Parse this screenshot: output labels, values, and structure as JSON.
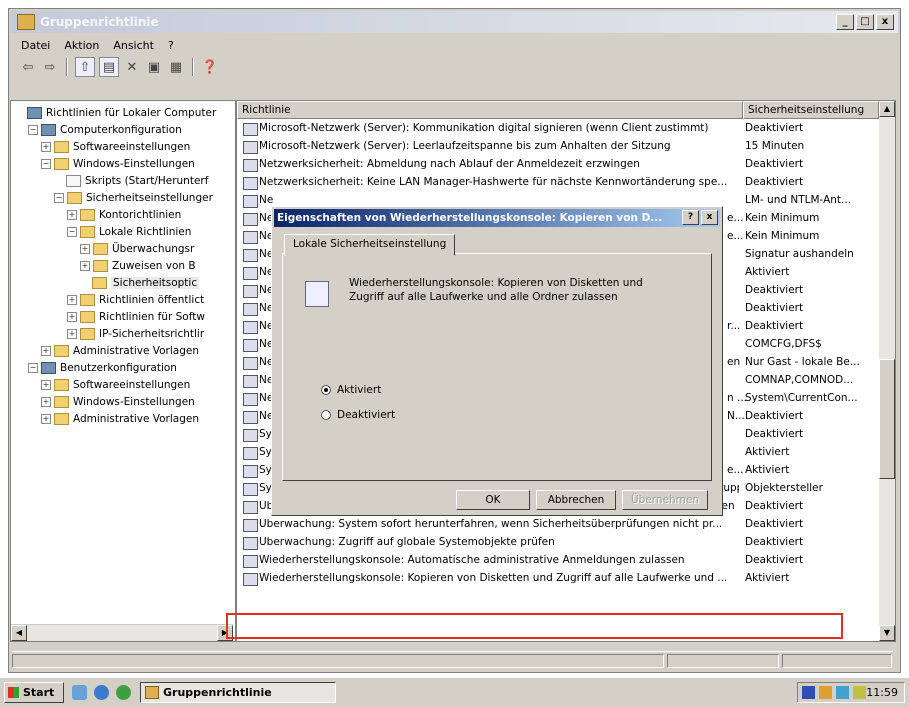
{
  "window": {
    "title": "Gruppenrichtlinie",
    "minimize": "_",
    "maximize": "□",
    "close": "x"
  },
  "menu": [
    "Datei",
    "Aktion",
    "Ansicht",
    "?"
  ],
  "tree": [
    {
      "label": "Richtlinien für Lokaler Computer",
      "indent": 0,
      "expander": "",
      "icon": "computer-policy-icon"
    },
    {
      "label": "Computerkonfiguration",
      "indent": 1,
      "expander": "−",
      "icon": "computer-icon"
    },
    {
      "label": "Softwareeinstellungen",
      "indent": 2,
      "expander": "+",
      "icon": "folder-icon"
    },
    {
      "label": "Windows-Einstellungen",
      "indent": 2,
      "expander": "−",
      "icon": "folder-icon"
    },
    {
      "label": "Skripts (Start/Herunterf",
      "indent": 3,
      "expander": "",
      "icon": "scripts-icon"
    },
    {
      "label": "Sicherheitseinstellunger",
      "indent": 3,
      "expander": "−",
      "icon": "security-icon"
    },
    {
      "label": "Kontorichtlinien",
      "indent": 4,
      "expander": "+",
      "icon": "folder-icon"
    },
    {
      "label": "Lokale Richtlinien",
      "indent": 4,
      "expander": "−",
      "icon": "folder-icon"
    },
    {
      "label": "Überwachungsr",
      "indent": 5,
      "expander": "+",
      "icon": "folder-icon"
    },
    {
      "label": "Zuweisen von B",
      "indent": 5,
      "expander": "+",
      "icon": "folder-icon"
    },
    {
      "label": "Sicherheitsoptic",
      "indent": 5,
      "expander": "",
      "icon": "folder-icon",
      "selected": true
    },
    {
      "label": "Richtlinien öffentlict",
      "indent": 4,
      "expander": "+",
      "icon": "folder-icon"
    },
    {
      "label": "Richtlinien für Softw",
      "indent": 4,
      "expander": "+",
      "icon": "folder-icon"
    },
    {
      "label": "IP-Sicherheitsrichtlir",
      "indent": 4,
      "expander": "+",
      "icon": "ip-security-icon"
    },
    {
      "label": "Administrative Vorlagen",
      "indent": 2,
      "expander": "+",
      "icon": "folder-icon"
    },
    {
      "label": "Benutzerkonfiguration",
      "indent": 1,
      "expander": "−",
      "icon": "user-icon"
    },
    {
      "label": "Softwareeinstellungen",
      "indent": 2,
      "expander": "+",
      "icon": "folder-icon"
    },
    {
      "label": "Windows-Einstellungen",
      "indent": 2,
      "expander": "+",
      "icon": "folder-icon"
    },
    {
      "label": "Administrative Vorlagen",
      "indent": 2,
      "expander": "+",
      "icon": "folder-icon"
    }
  ],
  "list": {
    "col_policy": "Richtlinie",
    "col_setting": "Sicherheitseinstellung",
    "rows": [
      {
        "policy": "Microsoft-Netzwerk (Server): Kommunikation digital signieren (wenn Client zustimmt)",
        "value": "Deaktiviert"
      },
      {
        "policy": "Microsoft-Netzwerk (Server): Leerlaufzeitspanne bis zum Anhalten der Sitzung",
        "value": "15 Minuten"
      },
      {
        "policy": "Netzwerksicherheit: Abmeldung nach Ablauf der Anmeldezeit erzwingen",
        "value": "Deaktiviert"
      },
      {
        "policy": "Netzwerksicherheit: Keine LAN Manager-Hashwerte für nächste Kennwortänderung spe...",
        "value": "Deaktiviert"
      },
      {
        "policy": "Ne",
        "value": "LM- und NTLM-Ant..."
      },
      {
        "policy": "Ne",
        "value": "Kein Minimum"
      },
      {
        "policy": "Ne",
        "value": "Kein Minimum"
      },
      {
        "policy": "Ne",
        "value": "Signatur aushandeln"
      },
      {
        "policy": "Ne",
        "value": "Aktiviert"
      },
      {
        "policy": "Ne",
        "value": "Deaktiviert"
      },
      {
        "policy": "Ne",
        "value": "Deaktiviert"
      },
      {
        "policy": "Ne",
        "value": "Deaktiviert"
      },
      {
        "policy": "Ne",
        "value": "COMCFG,DFS$"
      },
      {
        "policy": "Ne",
        "value": "Nur Gast - lokale Be..."
      },
      {
        "policy": "Ne",
        "value": "COMNAP,COMNOD..."
      },
      {
        "policy": "Ne",
        "value": "System\\CurrentCon..."
      },
      {
        "policy": "Ne",
        "value": "Deaktiviert"
      },
      {
        "policy": "Sy",
        "value": "Deaktiviert"
      },
      {
        "policy": "Sy",
        "value": "Aktiviert"
      },
      {
        "policy": "Sy",
        "value": "Aktiviert"
      },
      {
        "policy": "Systemobjekte: Standardbesitzer für Objekte, die von Mitgliedern der Administratorengruppe...",
        "value": "Objektersteller"
      },
      {
        "policy": "Überwachung: Die Verwendung des Sicherungs- und Wiederherstellungsrechts überprüfen",
        "value": "Deaktiviert"
      },
      {
        "policy": "Überwachung: System sofort herunterfahren, wenn Sicherheitsüberprüfungen nicht pr...",
        "value": "Deaktiviert"
      },
      {
        "policy": "Überwachung: Zugriff auf globale Systemobjekte prüfen",
        "value": "Deaktiviert"
      },
      {
        "policy": "Wiederherstellungskonsole: Automatische administrative Anmeldungen zulassen",
        "value": "Deaktiviert"
      },
      {
        "policy": "Wiederherstellungskonsole: Kopieren von Disketten und Zugriff auf alle Laufwerke und ...",
        "value": "Aktiviert"
      }
    ],
    "dialog_row_fragments": [
      "e...",
      "e...",
      "r...",
      "en",
      "n ...",
      "N...",
      "e..."
    ]
  },
  "dialog": {
    "title": "Eigenschaften von Wiederherstellungskonsole: Kopieren von D...",
    "help": "?",
    "close": "x",
    "tab": "Lokale Sicherheitseinstellung",
    "policy_text": "Wiederherstellungskonsole: Kopieren von Disketten und Zugriff auf alle Laufwerke und alle Ordner zulassen",
    "option_enabled": "Aktiviert",
    "option_disabled": "Deaktiviert",
    "selected_option": "Aktiviert",
    "ok": "OK",
    "cancel": "Abbrechen",
    "apply": "Übernehmen"
  },
  "taskbar": {
    "start": "Start",
    "task": "Gruppenrichtlinie",
    "clock": "11:59"
  }
}
